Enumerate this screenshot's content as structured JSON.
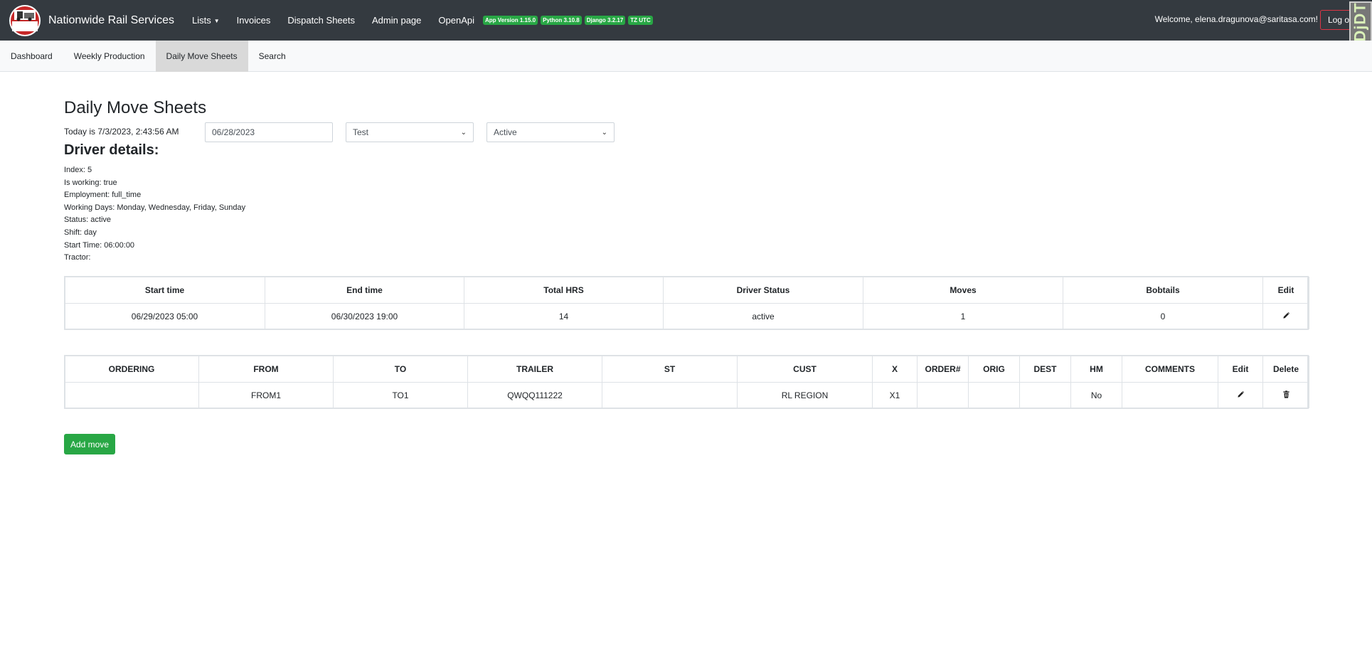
{
  "app": {
    "brand": "Nationwide Rail Services",
    "logo_text": "NRS"
  },
  "navbar": {
    "links": [
      {
        "label": "Lists",
        "dropdown": true
      },
      {
        "label": "Invoices"
      },
      {
        "label": "Dispatch Sheets"
      },
      {
        "label": "Admin page"
      },
      {
        "label": "OpenApi"
      }
    ],
    "badges": [
      "App Version 1.15.0",
      "Python 3.10.8",
      "Django 3.2.17",
      "TZ UTC"
    ],
    "welcome": "Welcome, elena.dragunova@saritasa.com!",
    "logout": "Log out",
    "djdt": "DjDT"
  },
  "subnav": {
    "items": [
      {
        "label": "Dashboard",
        "active": false
      },
      {
        "label": "Weekly Production",
        "active": false
      },
      {
        "label": "Daily Move Sheets",
        "active": true
      },
      {
        "label": "Search",
        "active": false
      }
    ]
  },
  "main": {
    "title": "Daily Move Sheets",
    "today": "Today is 7/3/2023, 2:43:56 AM",
    "date_value": "06/28/2023",
    "driver_select": "Test",
    "status_select": "Active",
    "driver_details_title": "Driver details:",
    "details": [
      "Index: 5",
      "Is working: true",
      "Employment: full_time",
      "Working Days: Monday, Wednesday, Friday, Sunday",
      "Status: active",
      "Shift: day",
      "Start Time: 06:00:00",
      "Tractor:"
    ]
  },
  "shift_table": {
    "headers": [
      "Start time",
      "End time",
      "Total HRS",
      "Driver Status",
      "Moves",
      "Bobtails",
      "Edit"
    ],
    "row": {
      "start": "06/29/2023 05:00",
      "end": "06/30/2023 19:00",
      "hours": "14",
      "status": "active",
      "moves": "1",
      "bobtails": "0"
    }
  },
  "moves_table": {
    "headers": [
      "ORDERING",
      "FROM",
      "TO",
      "TRAILER",
      "ST",
      "CUST",
      "X",
      "ORDER#",
      "ORIG",
      "DEST",
      "HM",
      "COMMENTS",
      "Edit",
      "Delete"
    ],
    "row": {
      "ordering": "",
      "from": "FROM1",
      "to": "TO1",
      "trailer": "QWQQ111222",
      "st": "",
      "cust": "RL REGION",
      "x": "X1",
      "order": "",
      "orig": "",
      "dest": "",
      "hm": "No",
      "comments": ""
    }
  },
  "actions": {
    "add_move": "Add move"
  }
}
